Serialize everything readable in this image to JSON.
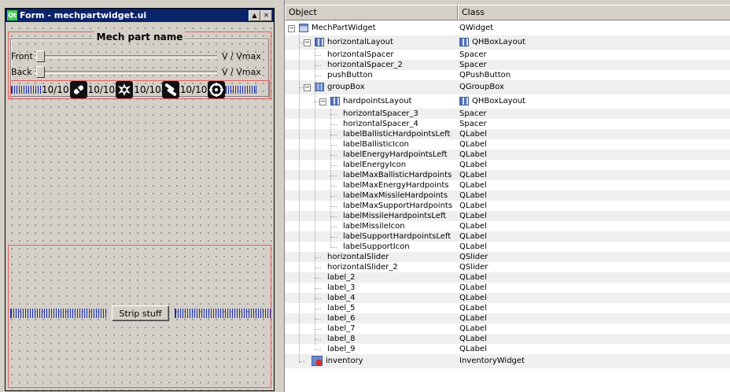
{
  "form": {
    "title": "Form - mechpartwidget.ui",
    "logo": "Qt",
    "group_title": "Mech part name",
    "sliders": [
      {
        "label": "Front",
        "suffix": "V  /  Vmax"
      },
      {
        "label": "Back",
        "suffix": "V  /  Vmax"
      }
    ],
    "hardpoints": [
      {
        "text": "10/10",
        "icon": "ballistic-icon"
      },
      {
        "text": "10/10",
        "icon": "energy-icon"
      },
      {
        "text": "10/10",
        "icon": "missile-icon"
      },
      {
        "text": "10/10",
        "icon": "support-icon"
      }
    ],
    "strip_button": "Strip stuff"
  },
  "inspector": {
    "col_object": "Object",
    "col_class": "Class",
    "rows": [
      {
        "name": "MechPartWidget",
        "cls": "QWidget",
        "icon": "widget-icon"
      },
      {
        "name": "horizontalLayout",
        "cls": "QHBoxLayout",
        "icon": "hbox-layout-icon"
      },
      {
        "name": "horizontalSpacer",
        "cls": "Spacer"
      },
      {
        "name": "horizontalSpacer_2",
        "cls": "Spacer"
      },
      {
        "name": "pushButton",
        "cls": "QPushButton"
      },
      {
        "name": "groupBox",
        "cls": "QGroupBox",
        "icon": "groupbox-icon"
      },
      {
        "name": "hardpointsLayout",
        "cls": "QHBoxLayout",
        "icon": "hbox-layout-icon"
      },
      {
        "name": "horizontalSpacer_3",
        "cls": "Spacer"
      },
      {
        "name": "horizontalSpacer_4",
        "cls": "Spacer"
      },
      {
        "name": "labelBallisticHardpointsLeft",
        "cls": "QLabel"
      },
      {
        "name": "labelBallisticIcon",
        "cls": "QLabel"
      },
      {
        "name": "labelEnergyHardpointsLeft",
        "cls": "QLabel"
      },
      {
        "name": "labelEnergyIcon",
        "cls": "QLabel"
      },
      {
        "name": "labelMaxBallisticHardpoints",
        "cls": "QLabel"
      },
      {
        "name": "labelMaxEnergyHardpoints",
        "cls": "QLabel"
      },
      {
        "name": "labelMaxMissileHardpoints",
        "cls": "QLabel"
      },
      {
        "name": "labelMaxSupportHardpoints",
        "cls": "QLabel"
      },
      {
        "name": "labelMissileHardpointsLeft",
        "cls": "QLabel"
      },
      {
        "name": "labelMissileIcon",
        "cls": "QLabel"
      },
      {
        "name": "labelSupportHardpointsLeft",
        "cls": "QLabel"
      },
      {
        "name": "labelSupportIcon",
        "cls": "QLabel"
      },
      {
        "name": "horizontalSlider",
        "cls": "QSlider"
      },
      {
        "name": "horizontalSlider_2",
        "cls": "QSlider"
      },
      {
        "name": "label_2",
        "cls": "QLabel"
      },
      {
        "name": "label_3",
        "cls": "QLabel"
      },
      {
        "name": "label_4",
        "cls": "QLabel"
      },
      {
        "name": "label_5",
        "cls": "QLabel"
      },
      {
        "name": "label_6",
        "cls": "QLabel"
      },
      {
        "name": "label_7",
        "cls": "QLabel"
      },
      {
        "name": "label_8",
        "cls": "QLabel"
      },
      {
        "name": "label_9",
        "cls": "QLabel"
      },
      {
        "name": "inventory",
        "cls": "InventoryWidget",
        "icon": "custom-widget-icon"
      }
    ]
  }
}
